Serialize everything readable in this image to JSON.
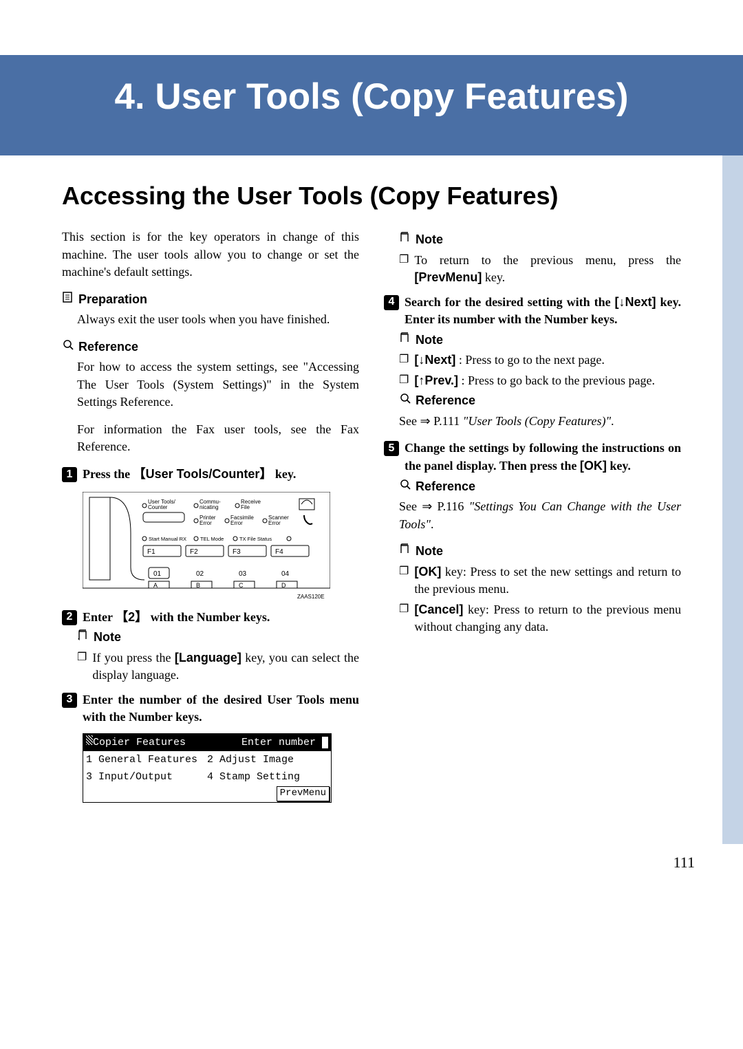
{
  "chapter": {
    "title": "4. User Tools (Copy Features)"
  },
  "section": {
    "heading": "Accessing the User Tools (Copy Features)"
  },
  "intro": "This section is for the key operators in change of this machine. The user tools allow you to change or set the machine's default settings.",
  "preparation": {
    "label": "Preparation",
    "text": "Always exit the user tools when you have finished."
  },
  "reference1": {
    "label": "Reference",
    "text1": "For how to access the system settings, see \"Accessing The User Tools (System Settings)\" in the System Settings Reference.",
    "text2": "For information the Fax user tools, see the Fax Reference."
  },
  "step1": {
    "pre": "Press the ",
    "key": "User Tools/Counter",
    "post": " key."
  },
  "step2": {
    "pre": "Enter ",
    "key": "2",
    "post": " with the Number keys."
  },
  "step2_note": {
    "label": "Note",
    "pre": "If you press the ",
    "key": "[Language]",
    "post": " key, you can select the display language."
  },
  "step3": {
    "text": "Enter the number of the desired User Tools menu with the Number keys."
  },
  "display": {
    "title": "Copier Features",
    "prompt": "Enter number",
    "opt1": "1 General Features",
    "opt2": "2 Adjust Image",
    "opt3": "3 Input/Output",
    "opt4": "4 Stamp Setting",
    "btn": "PrevMenu"
  },
  "step3_note": {
    "label": "Note",
    "pre": "To return to the previous menu, press the ",
    "key": "[PrevMenu]",
    "post": " key."
  },
  "step4": {
    "pre": "Search for the desired setting with the ",
    "key": "[↓Next]",
    "post": " key. Enter its number with the Number keys."
  },
  "step4_note": {
    "label": "Note",
    "b1_key": "[↓Next]",
    "b1_text": " : Press to go to the next page.",
    "b2_key": "[↑Prev.]",
    "b2_text": " : Press to go back to the previous page."
  },
  "step4_ref": {
    "label": "Reference",
    "pre": "See ⇒ P.111 ",
    "ital": "\"User Tools (Copy Features)\"",
    "post": "."
  },
  "step5": {
    "pre": "Change the settings by following the instructions on the panel display. Then press the ",
    "key": "[OK]",
    "post": " key."
  },
  "step5_ref": {
    "label": "Reference",
    "pre": "See ⇒ P.116 ",
    "ital": "\"Settings You Can Change with the User Tools\"",
    "post": "."
  },
  "step5_note": {
    "label": "Note",
    "b1_key": "[OK]",
    "b1_text": " key: Press to set the new settings and return to the previous menu.",
    "b2_key": "[Cancel]",
    "b2_text": " key: Press to return to the previous menu without changing any data."
  },
  "fig_labels": {
    "ut": "User Tools/\nCounter",
    "comm": "Commu-\nnicating",
    "recv": "Receive\nFile",
    "pe": "Printer\nError",
    "fe": "Facsimile\nError",
    "se": "Scanner\nError",
    "status": "Start Manual RX    TEL Mode    TX File Status",
    "f1": "F1",
    "f2": "F2",
    "f3": "F3",
    "f4": "F4",
    "n1": "01",
    "n2": "02",
    "n3": "03",
    "n4": "04",
    "caption": "ZAAS120E"
  },
  "page_number": "111"
}
